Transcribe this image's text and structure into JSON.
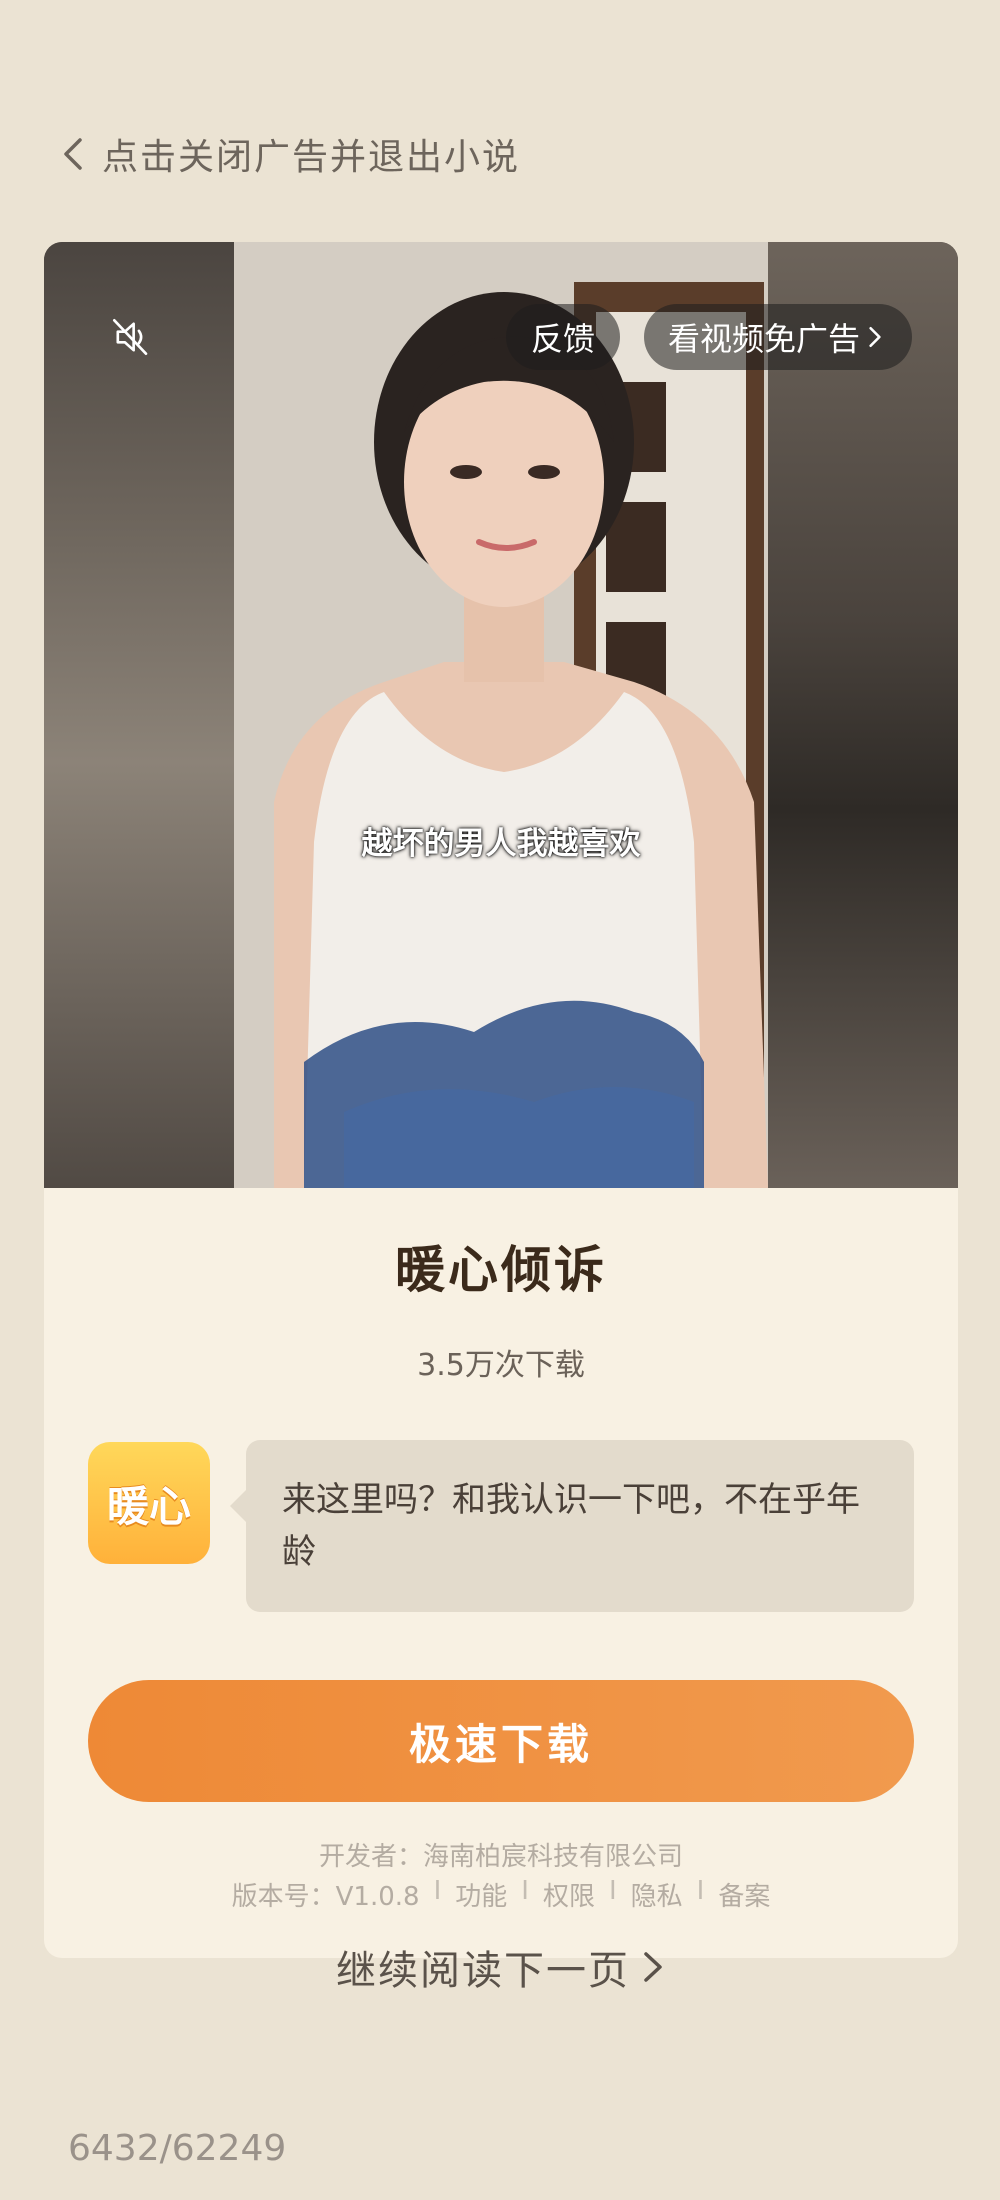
{
  "topbar": {
    "close_label": "点击关闭广告并退出小说"
  },
  "ad": {
    "subtitle": "越坏的男人我越喜欢",
    "feedback_label": "反馈",
    "skip_label": "看视频免广告",
    "app_name": "暖心倾诉",
    "downloads": "3.5万次下载",
    "icon_text": "暖心",
    "message": "来这里吗？和我认识一下吧，不在乎年龄",
    "download_button": "极速下载",
    "developer": "开发者：海南柏宸科技有限公司",
    "version": "版本号：V1.0.8",
    "links": [
      "功能",
      "权限",
      "隐私",
      "备案"
    ],
    "colors": {
      "button": "#ee8936",
      "card": "#f8f1e3",
      "background": "#ebe3d3"
    }
  },
  "footer": {
    "next_page_label": "继续阅读下一页",
    "page_counter": "6432/62249"
  }
}
